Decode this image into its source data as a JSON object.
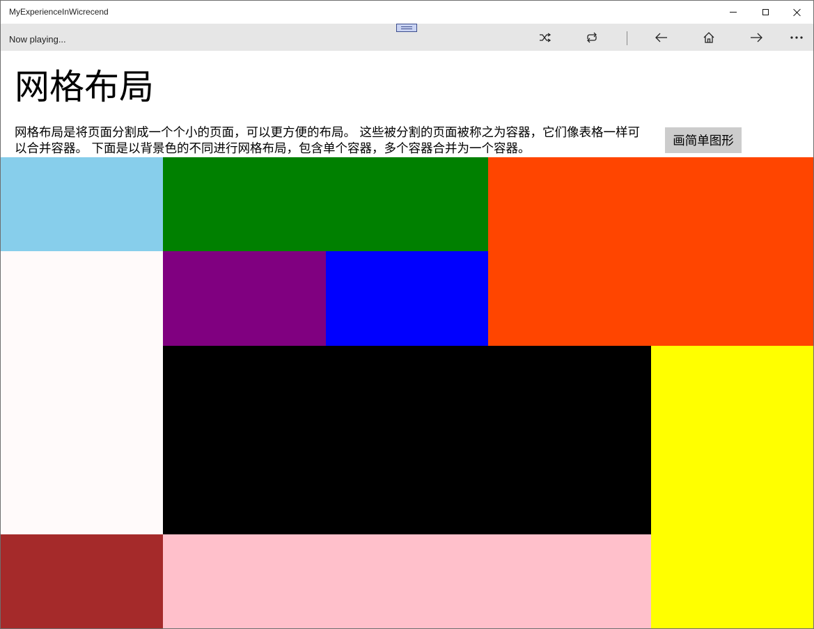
{
  "window": {
    "title": "MyExperienceInWicrecend"
  },
  "mediabar": {
    "now_playing": "Now playing...",
    "icons": [
      "shuffle-icon",
      "repeat-icon",
      "back-arrow-icon",
      "home-icon",
      "forward-arrow-icon",
      "more-icon"
    ]
  },
  "page": {
    "title": "网格布局",
    "description": "网格布局是将页面分割成一个个小的页面，可以更方便的布局。 这些被分割的页面被称之为容器，它们像表格一样可以合并容器。 下面是以背景色的不同进行网格布局，包含单个容器，多个容器合并为一个容器。",
    "button_label": "画简单图形"
  },
  "grid": {
    "cells": [
      {
        "name": "skyblue-cell",
        "color": "#87CEEB"
      },
      {
        "name": "green-cell",
        "color": "#008000"
      },
      {
        "name": "orangered-cell",
        "color": "#FF4500"
      },
      {
        "name": "snow-cell",
        "color": "#FFFAFA"
      },
      {
        "name": "purple-cell",
        "color": "#800080"
      },
      {
        "name": "blue-cell",
        "color": "#0000FF"
      },
      {
        "name": "black-cell",
        "color": "#000000"
      },
      {
        "name": "yellow-cell",
        "color": "#FFFF00"
      },
      {
        "name": "brown-cell",
        "color": "#A52A2A"
      },
      {
        "name": "pink-cell",
        "color": "#FFC0CB"
      }
    ]
  }
}
